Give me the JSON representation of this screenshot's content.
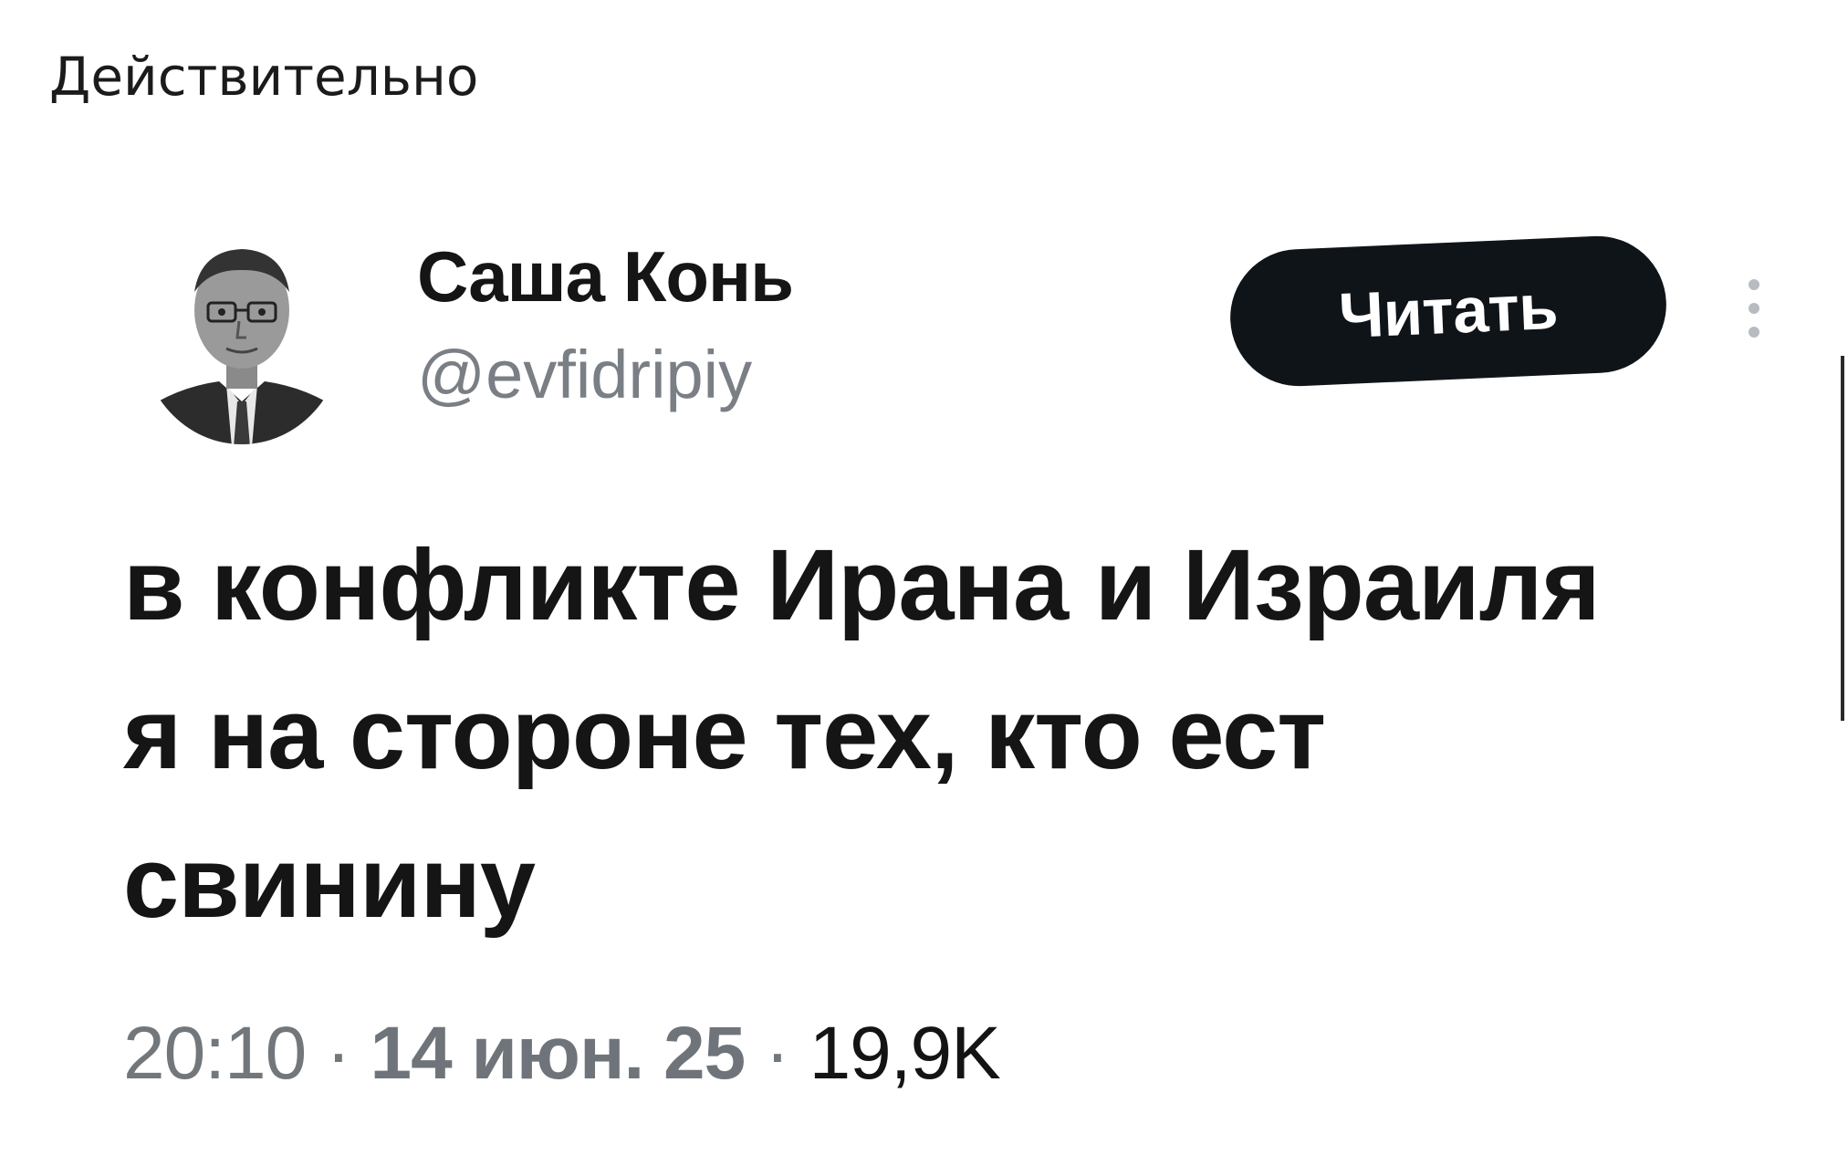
{
  "post": {
    "caption": "Действительно"
  },
  "tweet": {
    "author_name": "Саша Конь",
    "author_handle": "@evfidripiy",
    "follow_label": "Читать",
    "text_lines": [
      "в конфликте Ирана и Израиля",
      "я на стороне тех, кто ест",
      "свинину"
    ],
    "time": "20:10",
    "date": "14 июн. 25",
    "views": "19,9K",
    "icons": [
      "avatar",
      "more-icon"
    ]
  }
}
